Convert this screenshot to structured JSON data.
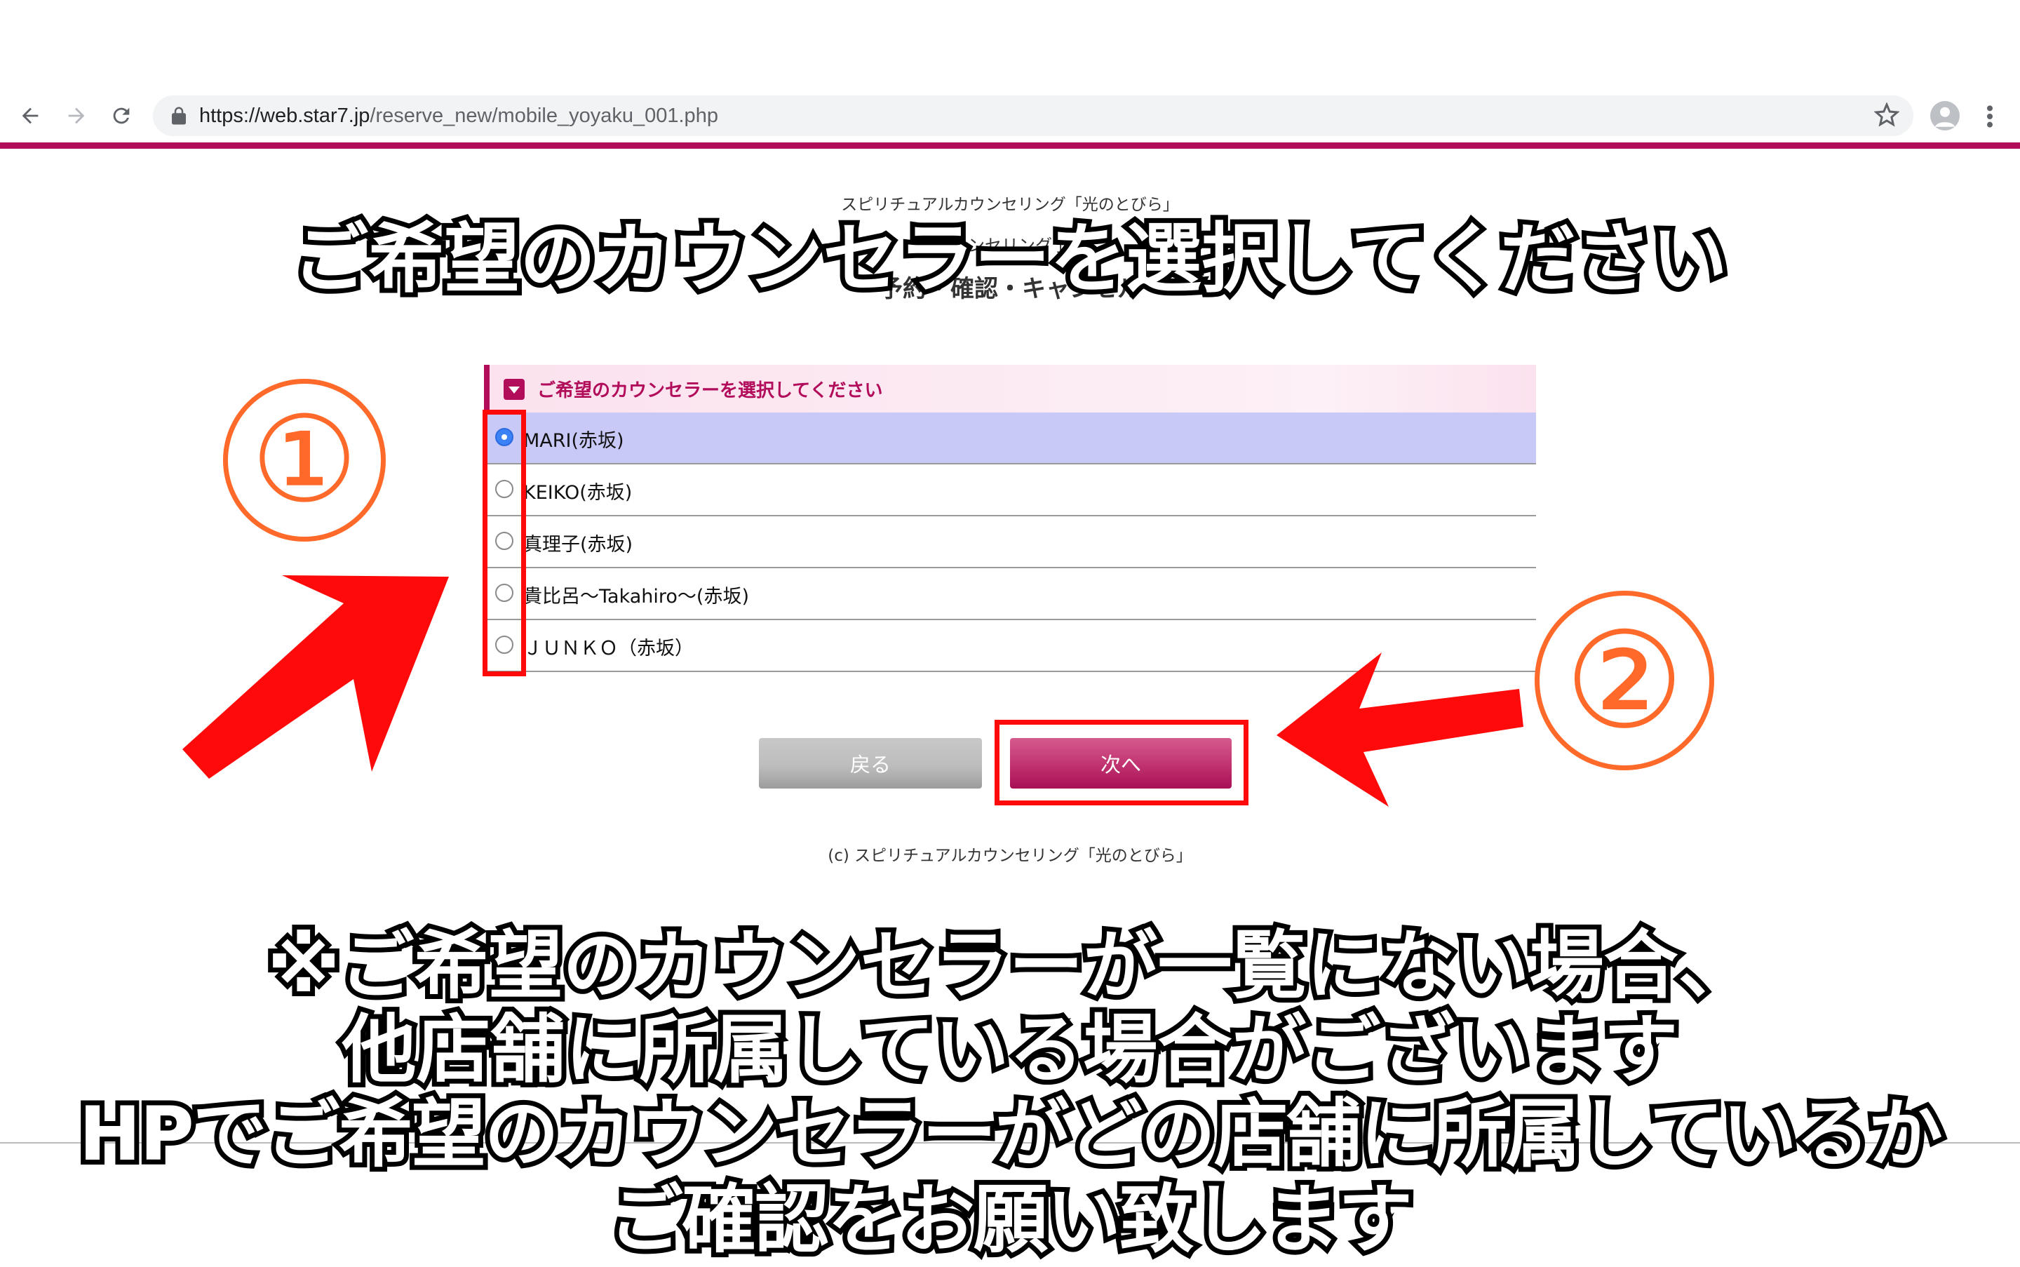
{
  "browser": {
    "url_host": "https://web.star7.jp",
    "url_path": "/reserve_new/mobile_yoyaku_001.php"
  },
  "page": {
    "subtitle_small": "スピリチュアルカウンセリング「光のとびら」",
    "subtitle_mid": "カウンセリング予約",
    "subtitle_large": "予約・確認・キャンセル",
    "panel_header": "ご希望のカウンセラーを選択してください",
    "counselors": [
      {
        "label": "MARI(赤坂)",
        "selected": true
      },
      {
        "label": "KEIKO(赤坂)",
        "selected": false
      },
      {
        "label": "真理子(赤坂)",
        "selected": false
      },
      {
        "label": "貴比呂〜Takahiro〜(赤坂)",
        "selected": false
      },
      {
        "label": "ＪＵＮＫＯ（赤坂）",
        "selected": false
      }
    ],
    "back_label": "戻る",
    "next_label": "次へ",
    "copyright": "(c) スピリチュアルカウンセリング「光のとびら」"
  },
  "overlay": {
    "title": "ご希望のカウンセラーを選択してください",
    "step1": "①",
    "step2": "②",
    "note_line1": "※ご希望のカウンセラーが一覧にない場合、",
    "note_line2": "他店舗に所属している場合がございます",
    "note_line3": "HPでご希望のカウンセラーがどの店舗に所属しているか",
    "note_line4": "ご確認をお願い致します"
  },
  "colors": {
    "brand": "#b20d5b",
    "selected_row": "#c9c9f7",
    "annotation_red": "#ff0a0a",
    "annotation_orange": "#ff6a2a"
  },
  "icons": {
    "back": "arrow-left-icon",
    "forward": "arrow-right-icon",
    "reload": "reload-icon",
    "lock": "lock-icon",
    "bookmark": "star-icon",
    "profile": "avatar-icon",
    "menu": "kebab-menu-icon",
    "header": "triangle-down-icon"
  }
}
